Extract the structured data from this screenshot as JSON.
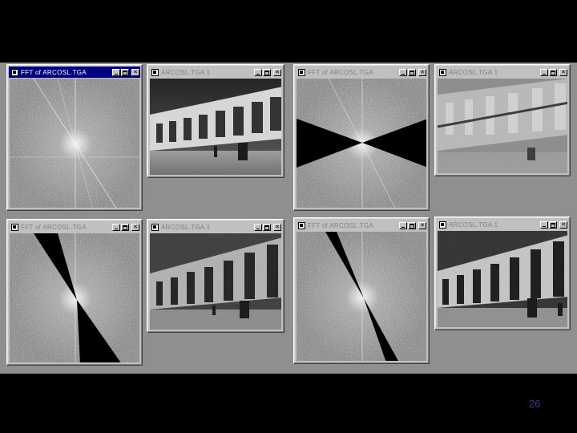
{
  "windows": [
    {
      "title": "FFT of ARCOSL.TGA",
      "state": "active",
      "content": "fft-full"
    },
    {
      "title": "ARCOSL.TGA 1",
      "state": "inactive",
      "content": "photo-filtered-a"
    },
    {
      "title": "FFT of ARCOSL.TGA",
      "state": "inactive",
      "content": "fft-masked-horizontal"
    },
    {
      "title": "ARCOSL.TGA 1",
      "state": "inactive",
      "content": "photo-filtered-b"
    },
    {
      "title": "FFT of ARCOSL.TGA",
      "state": "inactive",
      "content": "fft-masked-diagonal"
    },
    {
      "title": "ARCOSL.TGA 1",
      "state": "inactive",
      "content": "photo-filtered-c"
    },
    {
      "title": "FFT of ARCOSL.TGA",
      "state": "inactive",
      "content": "fft-masked-diagonal-narrow"
    },
    {
      "title": "ARCOSL.TGA 1",
      "state": "inactive",
      "content": "photo-filtered-d"
    }
  ],
  "title_buttons": {
    "minimize": "_",
    "maximize": "□",
    "close": "✕"
  },
  "page_number": "26",
  "colors": {
    "background": "#000000",
    "desktop": "#8f8f8f",
    "active_title": "#000080",
    "page_number": "#2e3a8c"
  }
}
